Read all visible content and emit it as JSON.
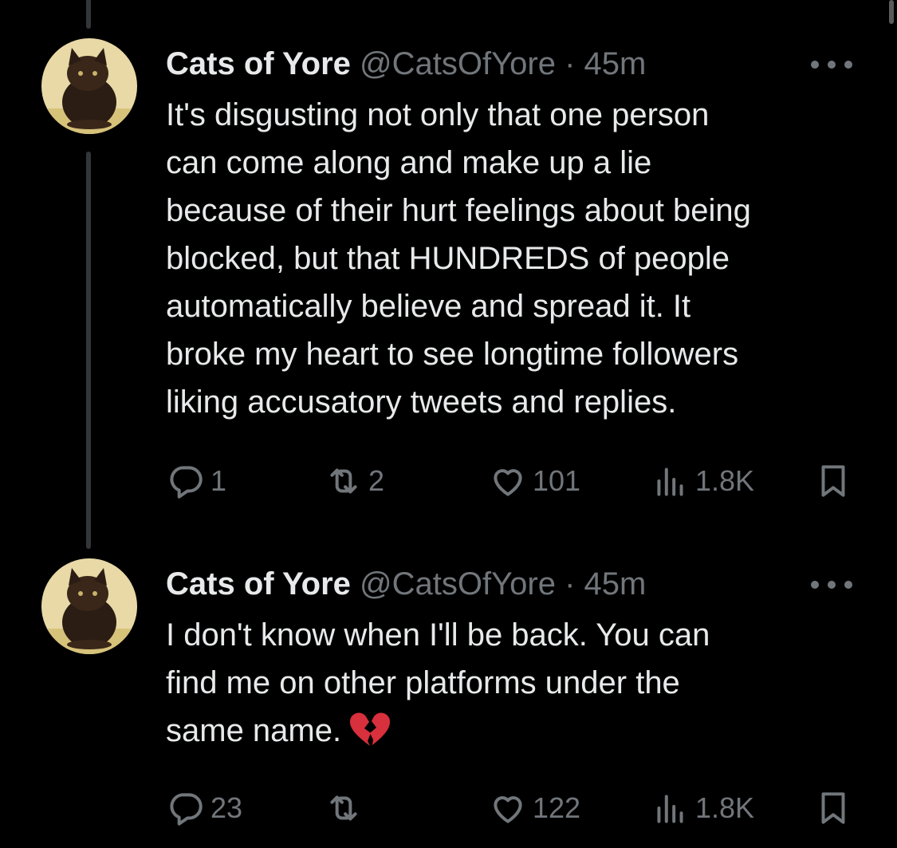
{
  "tweets": [
    {
      "name": "Cats of Yore",
      "handle": "@CatsOfYore",
      "separator": "·",
      "time": "45m",
      "lines": [
        "It's disgusting not only that one person",
        "can come along and make up a lie",
        "because of their hurt feelings about being",
        "blocked, but that HUNDREDS of people",
        "automatically believe and spread it. It",
        "broke my heart to see longtime followers",
        "liking accusatory tweets and replies."
      ],
      "replies": "1",
      "retweets": "2",
      "likes": "101",
      "views": "1.8K"
    },
    {
      "name": "Cats of Yore",
      "handle": "@CatsOfYore",
      "separator": "·",
      "time": "45m",
      "lines": [
        "I don't know when I'll be back. You can",
        "find me on other platforms under the",
        "same name."
      ],
      "emoji": "broken-heart-icon",
      "replies": "23",
      "retweets": "",
      "likes": "122",
      "views": "1.8K"
    }
  ],
  "colors": {
    "background": "#000000",
    "text": "#e7e9ea",
    "muted": "#71767b",
    "thread_line": "#333639",
    "emoji_red": "#d8303c"
  },
  "icons": [
    "reply-icon",
    "retweet-icon",
    "like-icon",
    "views-icon",
    "bookmark-icon",
    "more-icon"
  ]
}
